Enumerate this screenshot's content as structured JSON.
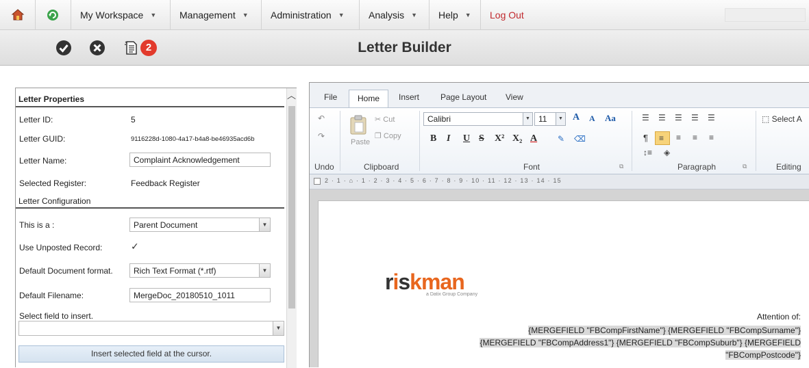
{
  "menu": {
    "items": [
      {
        "label": "My Workspace",
        "caret": "▼"
      },
      {
        "label": "Management",
        "caret": "▼"
      },
      {
        "label": "Administration",
        "caret": "▼"
      },
      {
        "label": "Analysis",
        "caret": "▼"
      },
      {
        "label": "Help",
        "caret": "▼"
      }
    ],
    "logout": "Log Out"
  },
  "toolbar": {
    "title": "Letter Builder",
    "badge_count": "2",
    "icons": [
      "save-check-icon",
      "cancel-x-icon",
      "document-icon"
    ]
  },
  "letter_properties": {
    "section_title": "Letter Properties",
    "id_label": "Letter ID:",
    "id_value": "5",
    "guid_label": "Letter GUID:",
    "guid_value": "9116228d-1080-4a17-b4a8-be46935acd6b",
    "name_label": "Letter Name:",
    "name_value": "Complaint Acknowledgement",
    "register_label": "Selected Register:",
    "register_value": "Feedback Register"
  },
  "letter_configuration": {
    "section_title": "Letter Configuration",
    "this_is_label": "This is a :",
    "this_is_value": "Parent Document",
    "unposted_label": "Use Unposted Record:",
    "unposted_checked": "✓",
    "format_label": "Default Document format.",
    "format_value": "Rich Text Format (*.rtf)",
    "filename_label": "Default Filename:",
    "filename_value": "MergeDoc_20180510_1011",
    "select_field_label": "Select field to insert.",
    "select_field_value": "",
    "insert_button": "Insert selected field at the cursor."
  },
  "editor": {
    "tabs": [
      "File",
      "Home",
      "Insert",
      "Page Layout",
      "View"
    ],
    "active_tab": "Home",
    "groups": {
      "undo": "Undo",
      "clipboard": "Clipboard",
      "font": "Font",
      "paragraph": "Paragraph",
      "editing": "Editing"
    },
    "clipboard": {
      "cut": "Cut",
      "copy": "Copy",
      "paste": "Paste"
    },
    "font_name": "Calibri",
    "font_size": "11",
    "format_buttons": [
      "B",
      "I",
      "U",
      "S",
      "X²",
      "X₂",
      "A"
    ],
    "size_buttons": [
      "A",
      "A",
      "Aa"
    ],
    "select_all": "Select A",
    "ruler": "2 · 1 · ⌂ · 1 · 2 · 3 · 4 · 5 · 6 · 7 · 8 · 9 · 10 · 11 · 12 · 13 · 14 · 15",
    "document": {
      "logo_text": "riskman",
      "logo_sub": "a Datix Group Company",
      "attention": "Attention of:",
      "merge_line1": "{MERGEFIELD \"FBCompFirstName\"} {MERGEFIELD \"FBCompSurname\"}",
      "merge_line2": "{MERGEFIELD \"FBCompAddress1\"} {MERGEFIELD \"FBCompSuburb\"} {MERGEFIELD",
      "merge_line3": "\"FBCompPostcode\"}"
    }
  },
  "colors": {
    "logout": "#c0282d",
    "badge": "#e23a2c",
    "logo_dark": "#333333",
    "logo_accent": "#e8661e"
  }
}
